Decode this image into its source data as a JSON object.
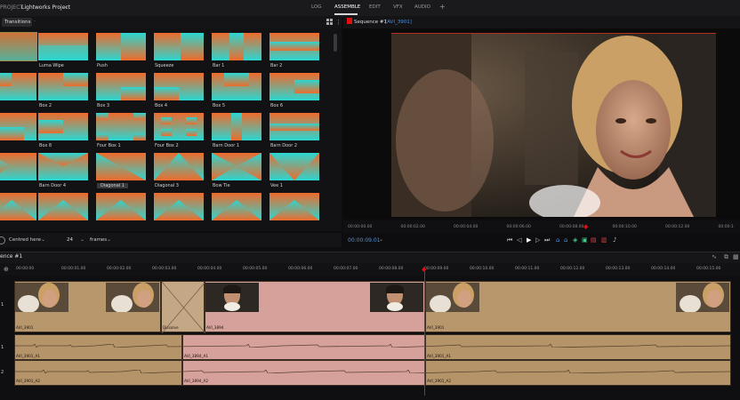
{
  "header": {
    "project_prefix": "PROJECT",
    "project_name": "Lightworks Project",
    "tabs": [
      "LOG",
      "ASSEMBLE",
      "EDIT",
      "VFX",
      "AUDIO"
    ],
    "active_tab": "ASSEMBLE",
    "add_tab": "+"
  },
  "transitions": {
    "tab_label": "Transitions",
    "items": [
      {
        "label": "",
        "style": "fade"
      },
      {
        "label": "Luma Wipe",
        "style": "luma"
      },
      {
        "label": "Push",
        "style": "push"
      },
      {
        "label": "Squeeze",
        "style": "squeeze"
      },
      {
        "label": "Bar 1",
        "style": "bar1"
      },
      {
        "label": "Bar 2",
        "style": "bar2"
      },
      {
        "label": "",
        "style": "box1"
      },
      {
        "label": "Box 2",
        "style": "box2"
      },
      {
        "label": "Box 3",
        "style": "box3"
      },
      {
        "label": "Box 4",
        "style": "box4"
      },
      {
        "label": "Box 5",
        "style": "box5"
      },
      {
        "label": "Box 6",
        "style": "box6"
      },
      {
        "label": "",
        "style": "box7"
      },
      {
        "label": "Box 8",
        "style": "box8"
      },
      {
        "label": "Four Box 1",
        "style": "four1"
      },
      {
        "label": "Four Box 2",
        "style": "four2"
      },
      {
        "label": "Barn Door 1",
        "style": "barn1"
      },
      {
        "label": "Barn Door 2",
        "style": "barn2"
      },
      {
        "label": "r 3",
        "style": "barn3"
      },
      {
        "label": "Barn Door 4",
        "style": "barn4"
      },
      {
        "label": "Diagonal 1",
        "style": "diag1"
      },
      {
        "label": "Diagonal 3",
        "style": "diag3"
      },
      {
        "label": "Bow Tie",
        "style": "bowtie"
      },
      {
        "label": "Vee 1",
        "style": "vee1"
      },
      {
        "label": "",
        "style": "vee2"
      },
      {
        "label": "",
        "style": "vee3"
      },
      {
        "label": "",
        "style": "vee4"
      },
      {
        "label": "",
        "style": "vee5"
      },
      {
        "label": "",
        "style": "vee6"
      },
      {
        "label": "",
        "style": "vee7"
      }
    ],
    "selected_label": "Diagonal 1",
    "footer": {
      "position_label": "Centred here",
      "frames_value": "24",
      "frames_label": "frames"
    }
  },
  "viewer": {
    "sequence_label": "Sequence #1",
    "clip_label": "[AVI_3901]",
    "ruler_ticks": [
      "00:00:00.00",
      "00:00:02.00",
      "00:00:04.00",
      "00:00:06.00",
      "00:00:08.00",
      "00:00:10.00",
      "00:00:12.00",
      "00:00:1"
    ],
    "timecode": "00:00:09.01",
    "playhead_seconds": 9.04
  },
  "timeline": {
    "sequence_label": "ence #1",
    "ruler_ticks": [
      "00:00:00",
      "00:00:01.00",
      "00:00:02.00",
      "00:00:03.00",
      "00:00:04.00",
      "00:00:05.00",
      "00:00:06.00",
      "00:00:07.00",
      "00:00:08.00",
      "00:00:09.00",
      "00:00:10.00",
      "00:00:11.00",
      "00:00:12.00",
      "00:00:13.00",
      "00:00:14.00",
      "00:00:15.00"
    ],
    "playhead_seconds": 9.04,
    "tracks": {
      "video": {
        "number": "1",
        "clips": [
          "AVI_3901",
          "Dissolve",
          "AVI_3894",
          "AVI_3901"
        ]
      },
      "audio1": {
        "number": "1",
        "clips": [
          "AVI_3901_A1",
          "AVI_3894_A1",
          "AVI_3901_A1"
        ]
      },
      "audio2": {
        "number": "2",
        "clips": [
          "AVI_3901_A2",
          "AVI_3894_A2",
          "AVI_3901_A2"
        ]
      }
    }
  },
  "colors": {
    "accent_red": "#e01010",
    "timecode_blue": "#4a90e2",
    "clip_tan": "#b8976c",
    "clip_selected": "#d6a19a",
    "gradient_top": "#f06a2a",
    "gradient_bottom": "#2ad7d2"
  }
}
